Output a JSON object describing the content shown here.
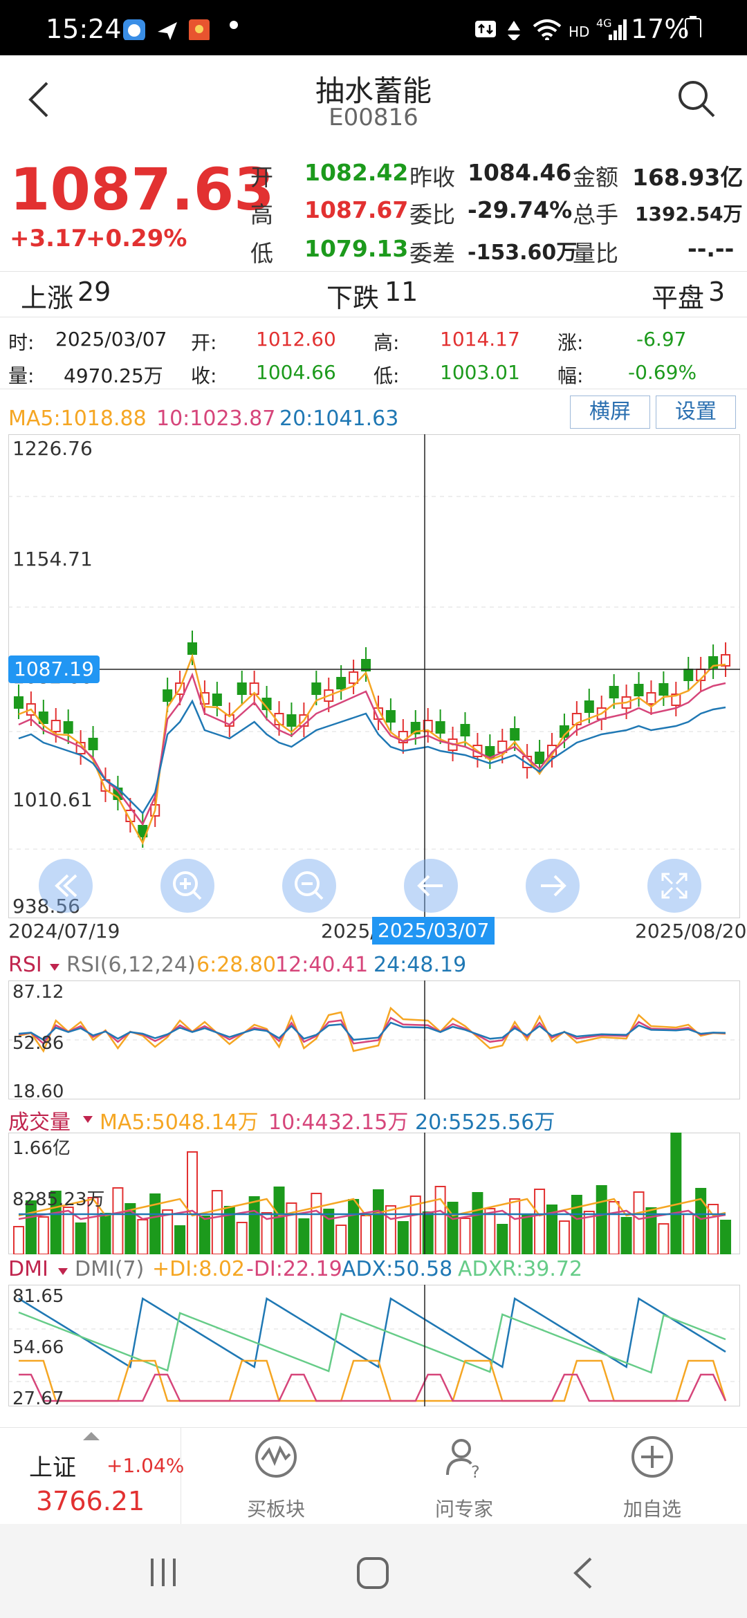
{
  "status_bar": {
    "time": "15:24",
    "network": "HD",
    "signal": "4G",
    "battery": "17%"
  },
  "header": {
    "title": "抽水蓄能",
    "code": "E00816"
  },
  "quote": {
    "price": "1087.63",
    "change": "+3.17",
    "change_pct": "+0.29%",
    "open_label": "开",
    "open": "1082.42",
    "high_label": "高",
    "high": "1087.67",
    "low_label": "低",
    "low": "1079.13",
    "prev_close_label": "昨收",
    "prev_close": "1084.46",
    "commit_ratio_label": "委比",
    "commit_ratio": "-29.74%",
    "commit_diff_label": "委差",
    "commit_diff": "-153.60万",
    "amount_label": "金额",
    "amount": "168.93亿",
    "volume_label": "总手",
    "volume": "1392.54万",
    "vol_ratio_label": "量比",
    "vol_ratio": "--.--"
  },
  "breadth": {
    "up_label": "上涨",
    "up": "29",
    "down_label": "下跌",
    "down": "11",
    "flat_label": "平盘",
    "flat": "3"
  },
  "crosshair_info": {
    "time_label": "时:",
    "time": "2025/03/07",
    "open_label": "开:",
    "open": "1012.60",
    "high_label": "高:",
    "high": "1014.17",
    "chg_label": "涨:",
    "chg": "-6.97",
    "vol_label": "量:",
    "vol": "4970.25万",
    "close_label": "收:",
    "close": "1004.66",
    "low_label": "低:",
    "low": "1003.01",
    "pct_label": "幅:",
    "pct": "-0.69%"
  },
  "ma_legend": {
    "ma5": "MA5:1018.88",
    "ma10": "10:1023.87",
    "ma20": "20:1041.63"
  },
  "buttons": {
    "landscape": "横屏",
    "settings": "设置"
  },
  "kline": {
    "y_ticks": [
      "1226.76",
      "1154.71",
      "1082.66",
      "1010.61",
      "938.56"
    ],
    "price_tag": "1087.19",
    "x_start": "2024/07/19",
    "x_mid": "2025/",
    "x_cursor": "2025/03/07",
    "x_end": "2025/08/20"
  },
  "rsi": {
    "name": "RSI",
    "params": "RSI(6,12,24)",
    "v6": "6:28.80",
    "v12": "12:40.41",
    "v24": "24:48.19",
    "ticks": [
      "87.12",
      "52.86",
      "18.60"
    ]
  },
  "vol_panel": {
    "name": "成交量",
    "ma5": "MA5:5048.14万",
    "ma10": "10:4432.15万",
    "ma20": "20:5525.56万",
    "ticks": [
      "1.66亿",
      "8285.23万"
    ]
  },
  "dmi": {
    "name": "DMI",
    "params": "DMI(7)",
    "pdi": "+DI:8.02",
    "mdi": "-DI:22.19",
    "adx": "ADX:50.58",
    "adxr": "ADXR:39.72",
    "ticks": [
      "81.65",
      "54.66",
      "27.67"
    ]
  },
  "bottom_nav": {
    "index_name": "上证",
    "index_pct": "+1.04%",
    "index_value": "3766.21",
    "items": [
      {
        "label": "买板块",
        "icon": "chart-wave-icon"
      },
      {
        "label": "问专家",
        "icon": "expert-icon"
      },
      {
        "label": "加自选",
        "icon": "add-circle-icon"
      }
    ]
  },
  "colors": {
    "up": "#e23131",
    "down": "#1c9a1c",
    "ma5": "#f5a623",
    "ma10": "#d6457a",
    "ma20": "#1f78b4",
    "adxr": "#66cc88"
  }
}
